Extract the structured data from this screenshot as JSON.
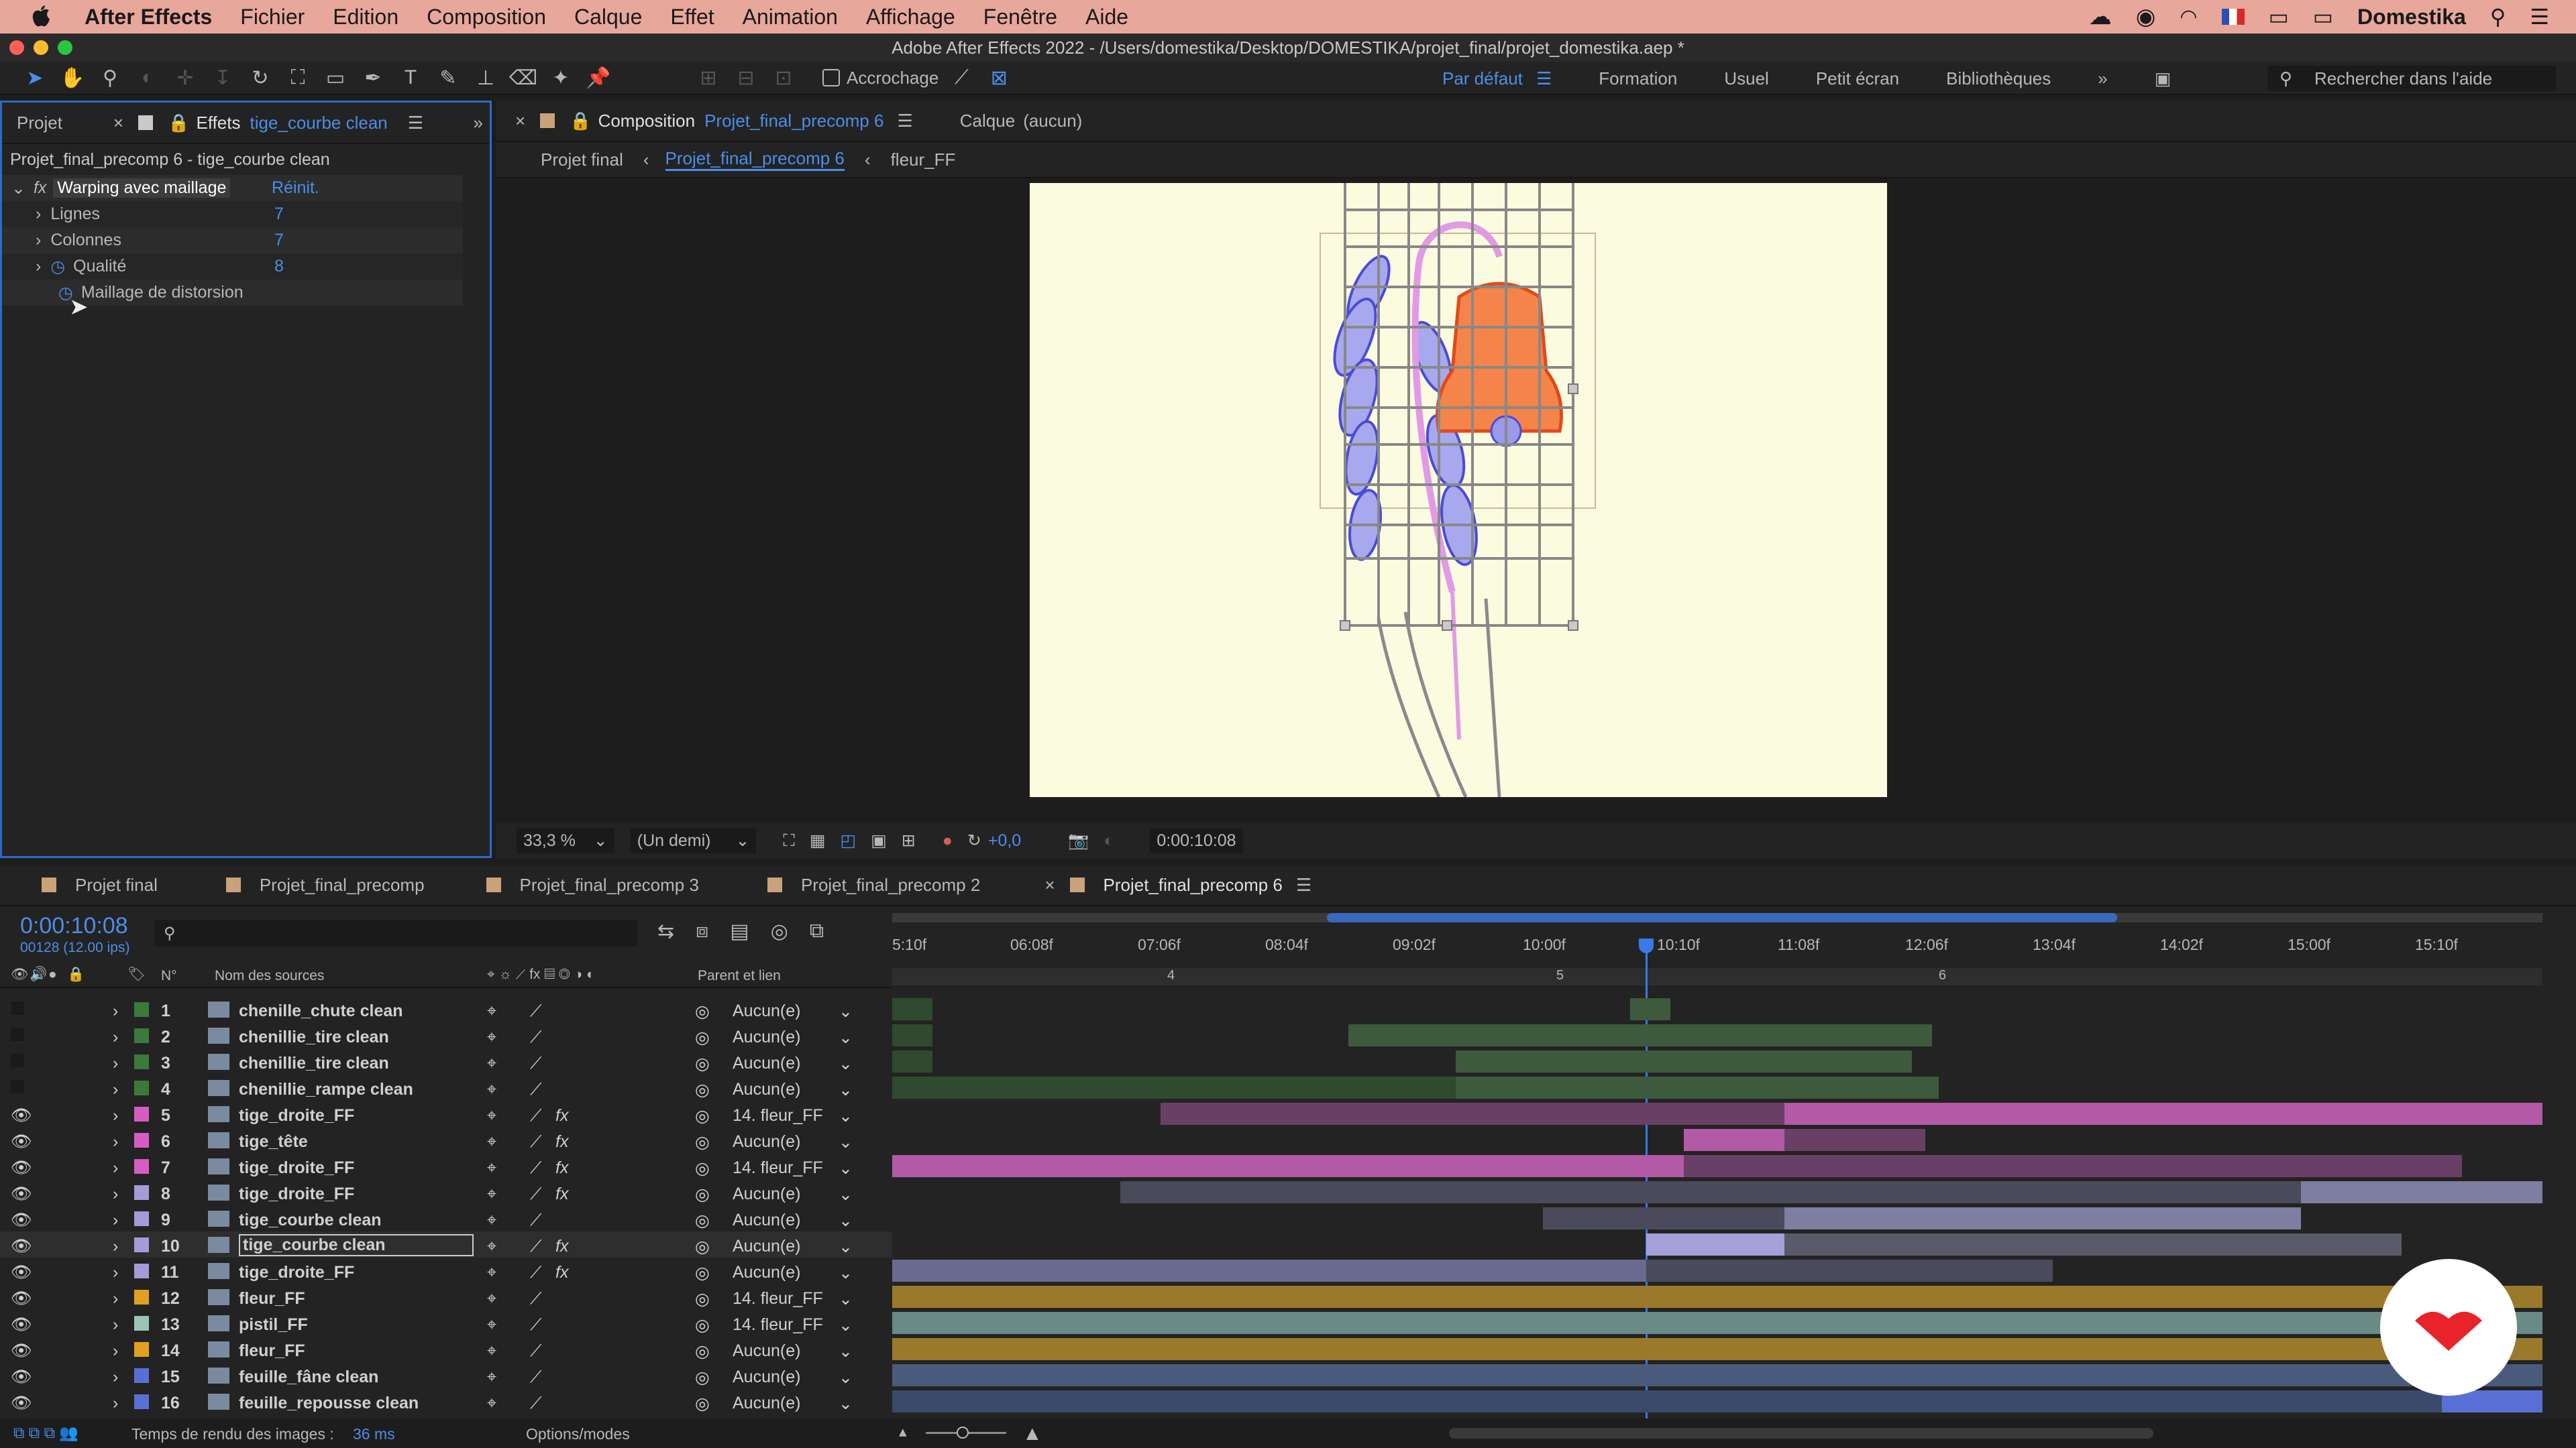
{
  "menubar": {
    "apple": "",
    "app": "After Effects",
    "items": [
      "Fichier",
      "Edition",
      "Composition",
      "Calque",
      "Effet",
      "Animation",
      "Affichage",
      "Fenêtre",
      "Aide"
    ],
    "user": "Domestika"
  },
  "window_title": "Adobe After Effects 2022 - /Users/domestika/Desktop/DOMESTIKA/projet_final/projet_domestika.aep *",
  "toolbar": {
    "snap_label": "Accrochage",
    "workspaces": [
      "Par défaut",
      "Formation",
      "Usuel",
      "Petit écran",
      "Bibliothèques"
    ],
    "help_placeholder": "Rechercher dans l'aide"
  },
  "effects_panel": {
    "tab_project": "Projet",
    "tab_effects": "Effets",
    "layer_name": "tige_courbe clean",
    "path": "Projet_final_precomp 6 - tige_courbe clean",
    "effect_name": "Warping avec maillage",
    "reset": "Réinit.",
    "props": [
      {
        "label": "Lignes",
        "value": "7"
      },
      {
        "label": "Colonnes",
        "value": "7"
      },
      {
        "label": "Qualité",
        "value": "8"
      },
      {
        "label": "Maillage de distorsion",
        "value": ""
      }
    ]
  },
  "comp_panel": {
    "tab_label": "Composition",
    "comp_name": "Projet_final_precomp 6",
    "layer_tab": "Calque",
    "layer_value": "(aucun)",
    "breadcrumbs": [
      "Projet final",
      "Projet_final_precomp 6",
      "fleur_FF"
    ]
  },
  "viewer": {
    "zoom": "33,3 %",
    "resolution": "(Un demi)",
    "exposure": "+0,0",
    "timecode": "0:00:10:08"
  },
  "timeline": {
    "tabs": [
      "Projet final",
      "Projet_final_precomp",
      "Projet_final_precomp 3",
      "Projet_final_precomp 2",
      "Projet_final_precomp 6"
    ],
    "timecode": "0:00:10:08",
    "frames": "00128 (12.00 ips)",
    "col_num": "N°",
    "col_source": "Nom des sources",
    "col_parent": "Parent et lien",
    "ruler": [
      "5:10f",
      "06:08f",
      "07:06f",
      "08:04f",
      "09:02f",
      "10:00f",
      "10:10f",
      "11:08f",
      "12:06f",
      "13:04f",
      "14:02f",
      "15:00f",
      "15:10f"
    ],
    "markers": [
      "4",
      "5",
      "6"
    ],
    "layers": [
      {
        "num": "1",
        "name": "chenille_chute clean",
        "parent": "Aucun(e)",
        "color": "#3a7a3a",
        "visible": false,
        "fx": false
      },
      {
        "num": "2",
        "name": "chenillie_tire clean",
        "parent": "Aucun(e)",
        "color": "#3a7a3a",
        "visible": false,
        "fx": false
      },
      {
        "num": "3",
        "name": "chenillie_tire clean",
        "parent": "Aucun(e)",
        "color": "#3a7a3a",
        "visible": false,
        "fx": false
      },
      {
        "num": "4",
        "name": "chenillie_rampe clean",
        "parent": "Aucun(e)",
        "color": "#3a7a3a",
        "visible": false,
        "fx": false
      },
      {
        "num": "5",
        "name": "tige_droite_FF",
        "parent": "14. fleur_FF",
        "color": "#d65cc3",
        "visible": true,
        "fx": true
      },
      {
        "num": "6",
        "name": "tige_tête",
        "parent": "Aucun(e)",
        "color": "#d65cc3",
        "visible": true,
        "fx": true
      },
      {
        "num": "7",
        "name": "tige_droite_FF",
        "parent": "14. fleur_FF",
        "color": "#d65cc3",
        "visible": true,
        "fx": true
      },
      {
        "num": "8",
        "name": "tige_droite_FF",
        "parent": "Aucun(e)",
        "color": "#a59bd6",
        "visible": true,
        "fx": true
      },
      {
        "num": "9",
        "name": "tige_courbe clean",
        "parent": "Aucun(e)",
        "color": "#a59bd6",
        "visible": true,
        "fx": false
      },
      {
        "num": "10",
        "name": "tige_courbe clean",
        "parent": "Aucun(e)",
        "color": "#a59bd6",
        "visible": true,
        "fx": true
      },
      {
        "num": "11",
        "name": "tige_droite_FF",
        "parent": "Aucun(e)",
        "color": "#a59bd6",
        "visible": true,
        "fx": true
      },
      {
        "num": "12",
        "name": "fleur_FF",
        "parent": "14. fleur_FF",
        "color": "#e0a020",
        "visible": true,
        "fx": false
      },
      {
        "num": "13",
        "name": "pistil_FF",
        "parent": "14. fleur_FF",
        "color": "#9cc3b8",
        "visible": true,
        "fx": false
      },
      {
        "num": "14",
        "name": "fleur_FF",
        "parent": "Aucun(e)",
        "color": "#e0a020",
        "visible": true,
        "fx": false
      },
      {
        "num": "15",
        "name": "feuille_fâne clean",
        "parent": "Aucun(e)",
        "color": "#5a6fd6",
        "visible": true,
        "fx": false
      },
      {
        "num": "16",
        "name": "feuille_repousse clean",
        "parent": "Aucun(e)",
        "color": "#5a6fd6",
        "visible": true,
        "fx": false
      }
    ],
    "render_label": "Temps de rendu des images :",
    "render_value": "36 ms",
    "options_label": "Options/modes"
  }
}
